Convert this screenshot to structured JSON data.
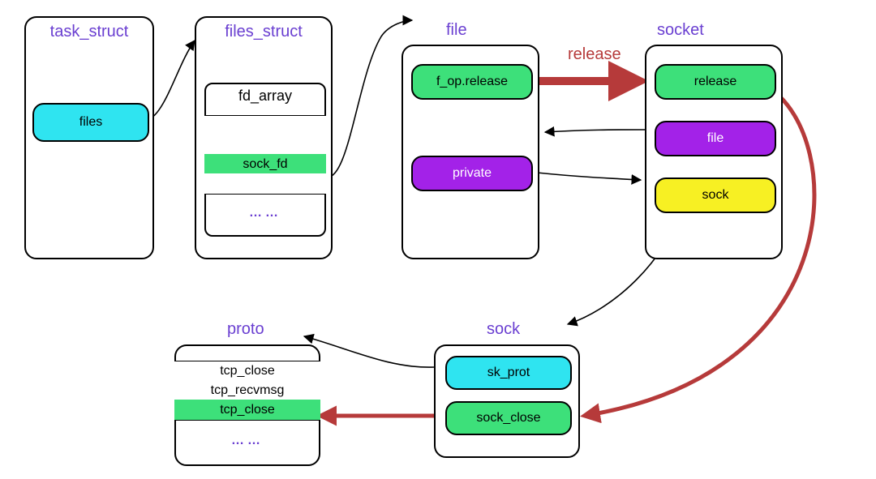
{
  "colors": {
    "cyan": "#2fe4f0",
    "green": "#3de07a",
    "purple": "#a322e8",
    "yellow": "#f7f023",
    "red": "#b63a3a",
    "titlePurple": "#6a3fd1"
  },
  "diagram": {
    "task_struct": {
      "title": "task_struct",
      "field_files": "files"
    },
    "files_struct": {
      "title": "files_struct",
      "fd_array_title": "fd_array",
      "sock_fd": "sock_fd",
      "ellipsis": "……"
    },
    "file": {
      "title": "file",
      "f_op_release": "f_op.release",
      "private": "private"
    },
    "socket": {
      "title": "socket",
      "release": "release",
      "file": "file",
      "sock": "sock"
    },
    "release_label": "release",
    "sock": {
      "title": "sock",
      "sk_prot": "sk_prot",
      "sock_close": "sock_close"
    },
    "proto": {
      "title": "proto",
      "rows": [
        "tcp_close",
        "tcp_recvmsg",
        "tcp_close"
      ],
      "highlight_index": 2,
      "ellipsis": "……"
    }
  },
  "arrows": [
    {
      "from": "task_struct.files",
      "to": "files_struct",
      "style": "thin"
    },
    {
      "from": "files_struct.sock_fd",
      "to": "file",
      "style": "thin"
    },
    {
      "from": "file.f_op_release",
      "to": "socket.release",
      "style": "thick-red",
      "label": "release"
    },
    {
      "from": "socket.file",
      "to": "file.private",
      "style": "thin",
      "bidir_hint": "back"
    },
    {
      "from": "file.private",
      "to": "socket.file",
      "style": "thin"
    },
    {
      "from": "socket.sock",
      "to": "sock",
      "style": "thin"
    },
    {
      "from": "sock.sk_prot",
      "to": "proto",
      "style": "thin"
    },
    {
      "from": "socket.release",
      "to": "sock.sock_close",
      "style": "thick-red-curve"
    },
    {
      "from": "sock.sock_close",
      "to": "proto.tcp_close",
      "style": "thick-red"
    }
  ]
}
